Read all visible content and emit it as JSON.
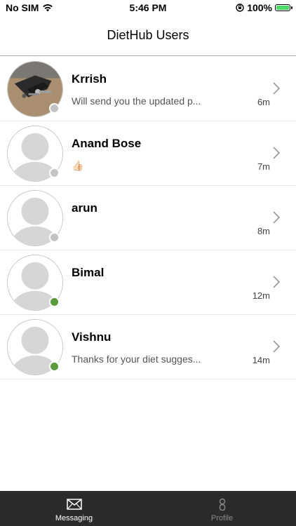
{
  "status_bar": {
    "carrier": "No SIM",
    "time": "5:46 PM",
    "battery": "100%"
  },
  "header": {
    "title": "DietHub Users"
  },
  "users": [
    {
      "name": "Krrish",
      "message": "Will send you the updated p...",
      "time": "6m",
      "online": false,
      "photo": true
    },
    {
      "name": "Anand Bose",
      "message": "👍🏻",
      "time": "7m",
      "online": false,
      "photo": false
    },
    {
      "name": "arun",
      "message": "",
      "time": "8m",
      "online": false,
      "photo": false
    },
    {
      "name": "Bimal",
      "message": "",
      "time": "12m",
      "online": true,
      "photo": false
    },
    {
      "name": "Vishnu",
      "message": "Thanks for your diet sugges...",
      "time": "14m",
      "online": true,
      "photo": false
    }
  ],
  "tabs": {
    "messaging": {
      "label": "Messaging",
      "active": true
    },
    "profile": {
      "label": "Profile",
      "active": false
    }
  },
  "colors": {
    "online": "#5a9b3c",
    "offline": "#c4c4c4",
    "tab_bar_bg": "#2b2b2b",
    "divider": "#a9a9a9"
  }
}
